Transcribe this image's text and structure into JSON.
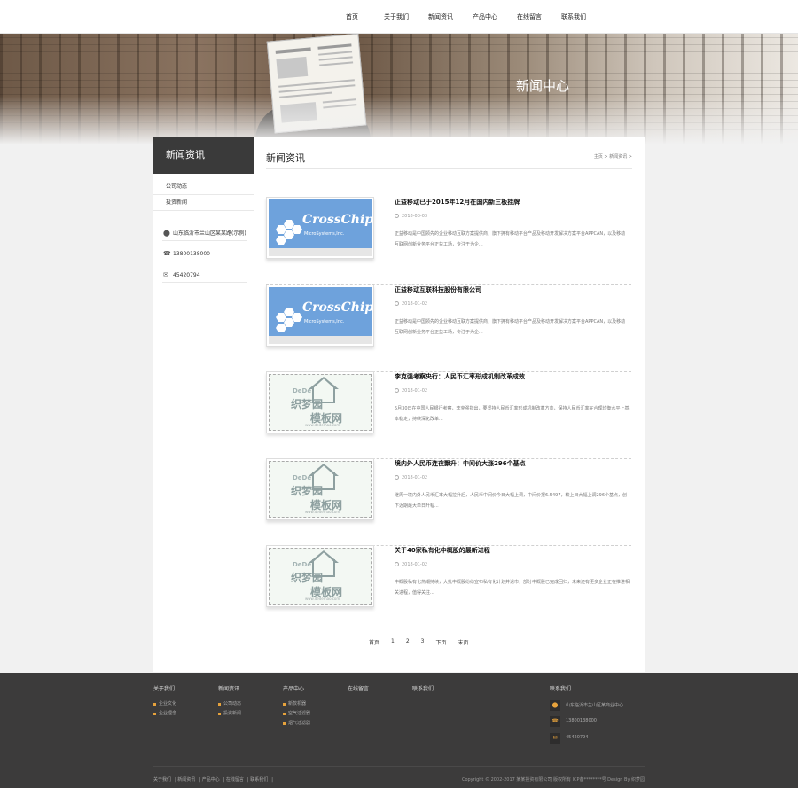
{
  "nav": {
    "items": [
      "首页",
      "关于我们",
      "新闻资讯",
      "产品中心",
      "在线留言",
      "联系我们"
    ]
  },
  "banner": {
    "title": "新闻中心"
  },
  "sidebar": {
    "title": "新闻资讯",
    "links": [
      "公司动态",
      "投资新闻"
    ],
    "contact": [
      {
        "icon": "location-pin-icon",
        "glyph": "⬤",
        "text": "山东临沂市兰山区某某路(示例)"
      },
      {
        "icon": "phone-icon",
        "glyph": "☎",
        "text": "13800138000"
      },
      {
        "icon": "envelope-icon",
        "glyph": "✉",
        "text": "45420794"
      }
    ]
  },
  "main": {
    "title": "新闻资讯",
    "breadcrumb": "主页 > 新闻资讯 >",
    "items": [
      {
        "title": "正益移动已于2015年12月在国内新三板挂牌",
        "date": "2018-03-03",
        "desc": "正益移动是中国领先的企业移动互联方案提供商，旗下拥有移动平台产品及移动开发解决方案平台APPCAN，以及移动互联网创新业务平台正益工场，专注于为企...",
        "thumb": "crosschip"
      },
      {
        "title": "正益移动互联科技股份有限公司",
        "date": "2018-01-02",
        "desc": "正益移动是中国领先的企业移动互联方案提供商，旗下拥有移动平台产品及移动开发解决方案平台APPCAN，以及移动互联网创新业务平台正益工场，专注于为企...",
        "thumb": "crosschip"
      },
      {
        "title": "李克强考察央行：人民币汇率形成机制改革成效",
        "date": "2018-01-02",
        "desc": "5月30日在中国人民银行考察，李克强指出，要坚持人民币汇率形成机制改革方向，保持人民币汇率在合理均衡水平上基本稳定，持续深化改革...",
        "thumb": "dede"
      },
      {
        "title": "境内外人民币连夜飘升：中间价大涨296个基点",
        "date": "2018-01-02",
        "desc": "继周一境内外人民币汇率大幅拉升后，人民币中间价今日大幅上调，中间价报6.5497，较上日大幅上调296个基点，创下近期最大单日升幅...",
        "thumb": "dede"
      },
      {
        "title": "关于40家私有化中概股的最新进程",
        "date": "2018-01-02",
        "desc": "中概股私有化热潮持续，大批中概股纷纷宣布私有化计划并退市，部分中概股已完成回归，未来还有更多企业正在推进相关进程，值得关注...",
        "thumb": "dede"
      }
    ],
    "thumb_text": {
      "crosschip_main": "CrossChip",
      "crosschip_sub": "MicroSystems,Inc.",
      "dede_top": "DeDe",
      "dede_mid": "织梦园",
      "dede_bot": "模板网",
      "dede_url": "www.dedemao.com"
    },
    "pager": [
      "首页",
      "1",
      "2",
      "3",
      "下页",
      "末页"
    ]
  },
  "footer": {
    "columns": [
      {
        "heading": "关于我们",
        "items": [
          "企业文化",
          "企业理念"
        ]
      },
      {
        "heading": "新闻资讯",
        "items": [
          "公司动态",
          "投资新闻"
        ]
      },
      {
        "heading": "产品中心",
        "items": [
          "新款机器",
          "空气过滤器",
          "烟气过滤器"
        ]
      },
      {
        "heading": "在线留言",
        "items": []
      },
      {
        "heading": "联系我们",
        "items": []
      }
    ],
    "contact": {
      "heading": "联系我们",
      "rows": [
        {
          "icon": "location-pin-icon",
          "glyph": "⬤",
          "text": "山东临沂市兰山区某商业中心"
        },
        {
          "icon": "phone-icon",
          "glyph": "☎",
          "text": "13800138000"
        },
        {
          "icon": "envelope-icon",
          "glyph": "✉",
          "text": "45420794"
        }
      ]
    },
    "links": [
      "关于我们",
      "新闻资讯",
      "产品中心",
      "在线留言",
      "联系我们"
    ],
    "copyright": "Copyright © 2002-2017 某某投资有限公司 版权所有 ICP备********号 Design By 织梦园"
  },
  "colors": {
    "accent": "#e6a23c",
    "sidebar_head": "#3a3a3a",
    "footer_bg": "#3c3b3b",
    "thumb_blue": "#6ea2dc"
  }
}
